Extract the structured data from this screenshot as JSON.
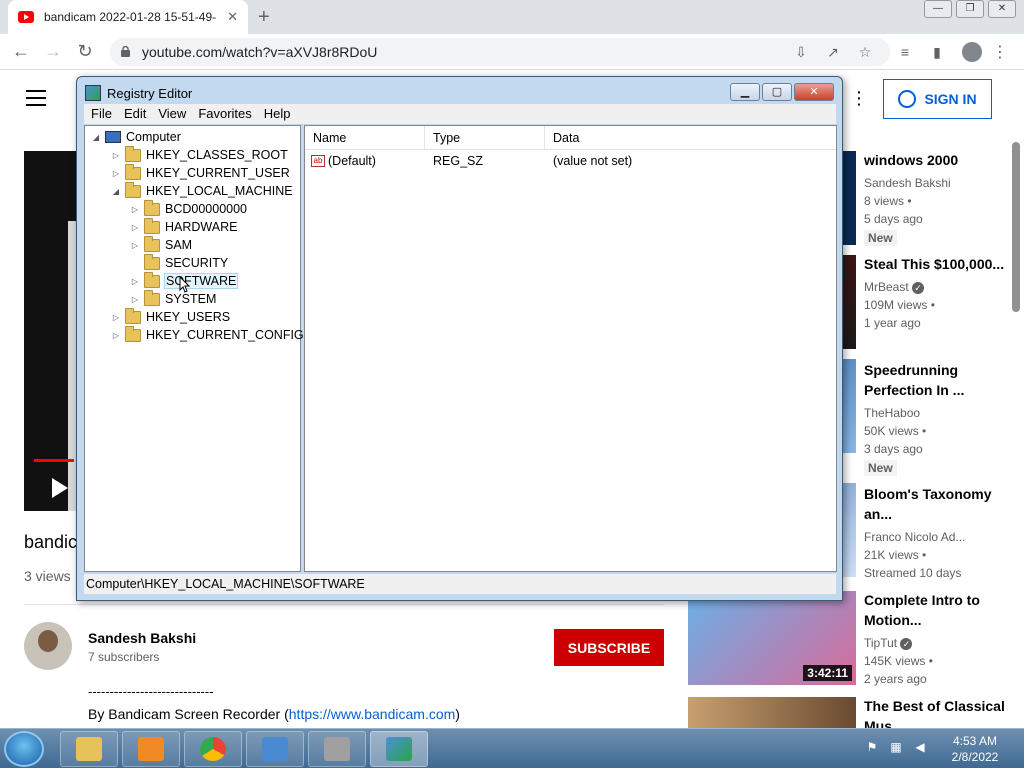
{
  "browser": {
    "tab_title": "bandicam 2022-01-28 15-51-49-",
    "tab_close": "✕",
    "new_tab": "+",
    "url": "youtube.com/watch?v=aXVJ8r8RDoU",
    "win_min": "—",
    "win_max": "❐",
    "win_close": "✕"
  },
  "youtube": {
    "sign_in": "SIGN IN",
    "video_title": "bandic",
    "views": "3 views",
    "channel_name": "Sandesh Bakshi",
    "channel_subs": "7 subscribers",
    "subscribe": "SUBSCRIBE",
    "desc_line1": "-----------------------------",
    "desc_line2_prefix": "By Bandicam Screen Recorder (",
    "desc_link": "https://www.bandicam.com",
    "desc_line2_suffix": ")",
    "recommendations": [
      {
        "title": "windows 2000",
        "channel": "Sandesh Bakshi",
        "views": "8 views •",
        "age": "5 days ago",
        "badge": "New",
        "duration": ""
      },
      {
        "title": "Steal This $100,000...",
        "channel": "MrBeast",
        "views": "109M views •",
        "age": "1 year ago",
        "badge": "",
        "duration": ""
      },
      {
        "title": "Speedrunning Perfection In ...",
        "channel": "TheHaboo",
        "views": "50K views •",
        "age": "3 days ago",
        "badge": "New",
        "duration": ""
      },
      {
        "title": "Bloom's Taxonomy an...",
        "channel": "Franco Nicolo Ad...",
        "views": "21K views •",
        "age": "Streamed 10 days",
        "badge": "",
        "duration": ""
      },
      {
        "title": "Complete Intro to Motion...",
        "channel": "TipTut",
        "views": "145K views •",
        "age": "2 years ago",
        "badge": "",
        "duration": "3:42:11"
      },
      {
        "title": "The Best of Classical Mus...",
        "channel": "",
        "views": "",
        "age": "",
        "badge": "",
        "duration": ""
      }
    ]
  },
  "regedit": {
    "title": "Registry Editor",
    "ctrl_min": "▁",
    "ctrl_max": "▢",
    "ctrl_close": "✕",
    "menu": [
      "File",
      "Edit",
      "View",
      "Favorites",
      "Help"
    ],
    "tree": {
      "root": "Computer",
      "hives": [
        "HKEY_CLASSES_ROOT",
        "HKEY_CURRENT_USER",
        "HKEY_LOCAL_MACHINE",
        "HKEY_USERS",
        "HKEY_CURRENT_CONFIG"
      ],
      "hklm_children": [
        "BCD00000000",
        "HARDWARE",
        "SAM",
        "SECURITY",
        "SOFTWARE",
        "SYSTEM"
      ]
    },
    "columns": {
      "name": "Name",
      "type": "Type",
      "data": "Data"
    },
    "rows": [
      {
        "name": "(Default)",
        "type": "REG_SZ",
        "data": "(value not set)"
      }
    ],
    "status": "Computer\\HKEY_LOCAL_MACHINE\\SOFTWARE"
  },
  "taskbar": {
    "time": "4:53 AM",
    "date": "2/8/2022"
  }
}
